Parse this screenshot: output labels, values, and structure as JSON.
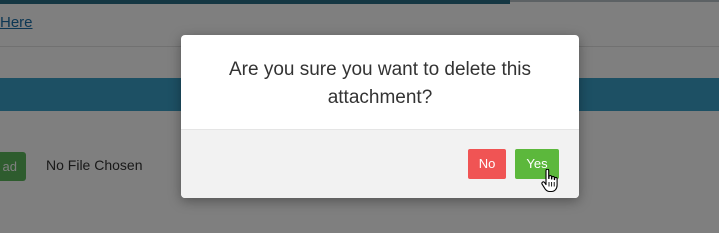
{
  "background": {
    "link_text": "Here",
    "upload_button_label": "Upload",
    "upload_button_visible": "ad",
    "file_status": "No File Chosen",
    "colors": {
      "topbar": "#2a6f86",
      "band": "#3aa1c8",
      "upload_button": "#5cb85c"
    }
  },
  "dialog": {
    "message": "Are you sure you want to delete this attachment?",
    "no_label": "No",
    "yes_label": "Yes",
    "colors": {
      "no_button": "#f05454",
      "yes_button": "#5cb83c"
    }
  },
  "cursor": {
    "icon": "hand-pointer-icon"
  }
}
